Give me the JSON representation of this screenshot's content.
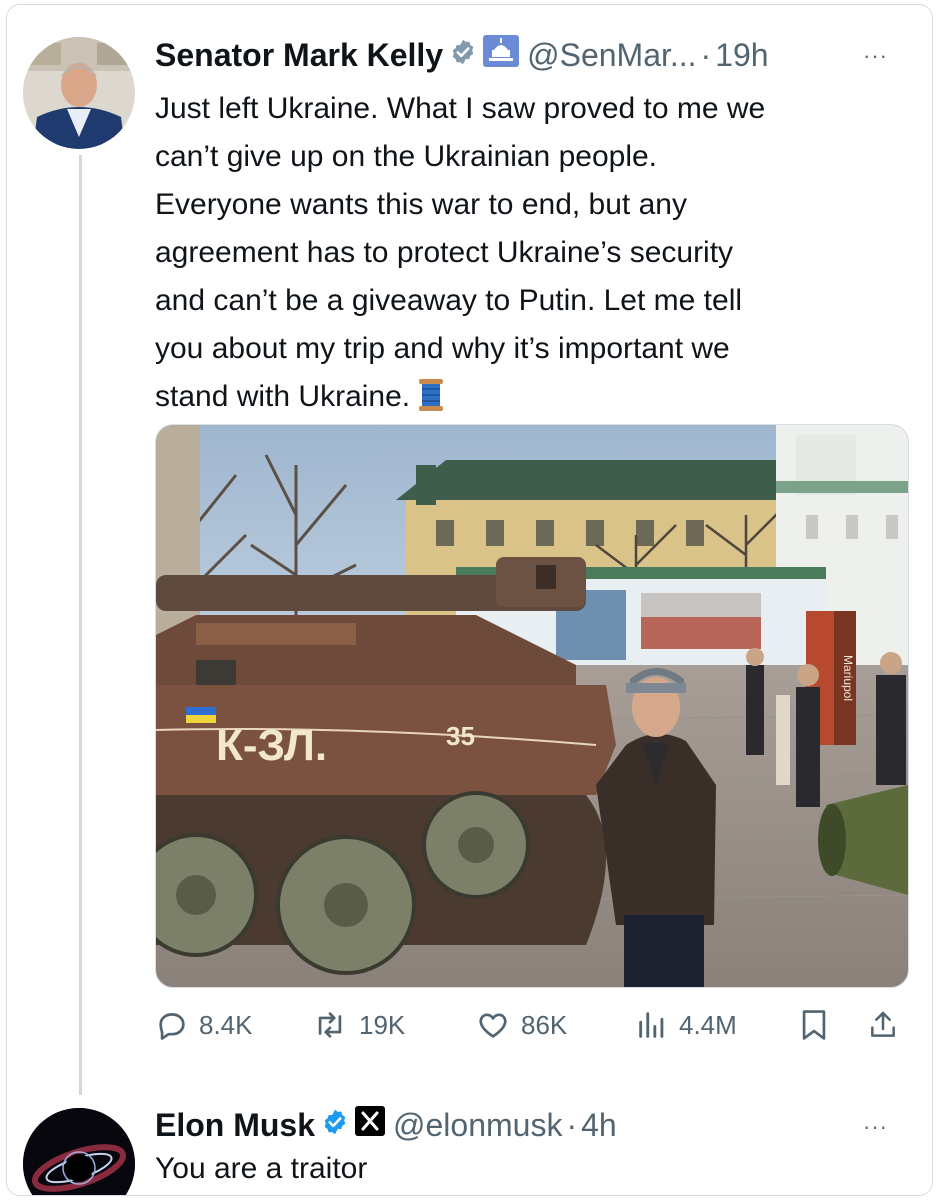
{
  "tweet": {
    "author_name": "Senator Mark Kelly",
    "handle": "@SenMar...",
    "separator": "·",
    "time": "19h",
    "more": "···",
    "lines": [
      "Just left Ukraine. What I saw proved to me we",
      "can’t give up on the Ukrainian people.",
      "Everyone wants this war to end, but any",
      "agreement has to protect Ukraine’s security",
      "and can’t be a giveaway to Putin. Let me tell",
      "you about my trip and why it’s important we",
      "stand with Ukraine."
    ],
    "emoji_icon": "thread-spool-icon",
    "photo_sign_text": "Mariupol",
    "stats": {
      "replies": "8.4K",
      "reposts": "19K",
      "likes": "86K",
      "views": "4.4M"
    }
  },
  "reply": {
    "author_name": "Elon Musk",
    "handle": "@elonmusk",
    "separator": "·",
    "time": "4h",
    "more": "···",
    "text": "You are a traitor"
  },
  "colors": {
    "verified_blue": "#1d9bf0",
    "muted": "#536471",
    "text": "#0f1419",
    "thread_line": "#cfd9de"
  }
}
